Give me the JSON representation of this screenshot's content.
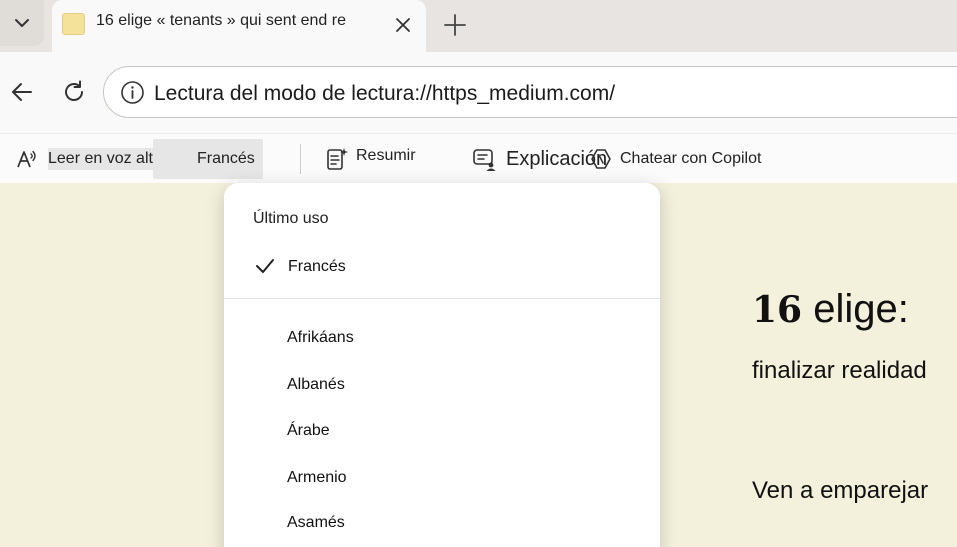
{
  "tab": {
    "title": "16 elige « tenants » qui sent end re"
  },
  "address_bar": {
    "url": "Lectura del modo de lectura://https_medium.com/"
  },
  "reader_toolbar": {
    "read_aloud_label": "Leer en voz alta ab",
    "language_selected": "Francés",
    "summarize_label": "Resumir",
    "explain_label": "Explicación",
    "copilot_label": "Chatear con Copilot"
  },
  "language_menu": {
    "section_label": "Último uso",
    "selected": "Francés",
    "items": [
      "Afrikáans",
      "Albanés",
      "Árabe",
      "Armenio",
      "Asamés"
    ]
  },
  "article": {
    "title_number": "16",
    "title_text": "elige:",
    "subtitle": "finalizar realidad",
    "paragraph": "Ven a emparejar"
  },
  "colors": {
    "page_background": "#f3f0dc",
    "tab_favicon": "#f4e29b"
  }
}
